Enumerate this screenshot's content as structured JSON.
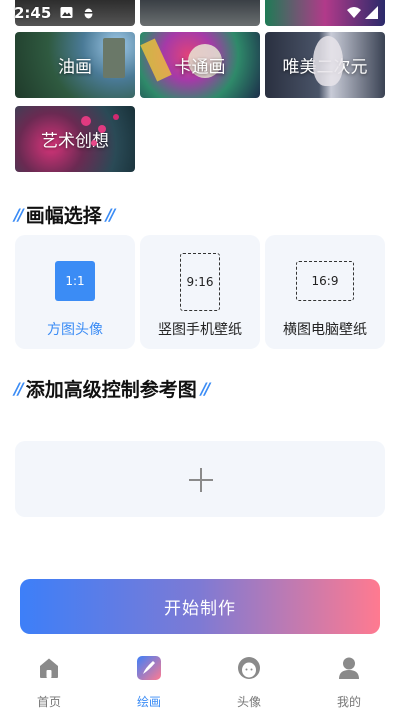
{
  "status_bar": {
    "time": "2:45",
    "icons": [
      "image-icon",
      "bug-icon",
      "wifi-icon",
      "signal-icon"
    ]
  },
  "styles": {
    "items": [
      {
        "label": "油画"
      },
      {
        "label": "卡通画"
      },
      {
        "label": "唯美二次元"
      },
      {
        "label": "艺术创想"
      }
    ]
  },
  "ratio_section": {
    "title": "画幅选择",
    "options": [
      {
        "ratio": "1:1",
        "label": "方图头像",
        "selected": true
      },
      {
        "ratio": "9:16",
        "label": "竖图手机壁纸",
        "selected": false
      },
      {
        "ratio": "16:9",
        "label": "横图电脑壁纸",
        "selected": false
      }
    ]
  },
  "reference_section": {
    "title": "添加高级控制参考图"
  },
  "start_button": {
    "label": "开始制作"
  },
  "tabbar": {
    "items": [
      {
        "label": "首页",
        "icon": "home-icon",
        "active": false
      },
      {
        "label": "绘画",
        "icon": "paint-brush-icon",
        "active": true
      },
      {
        "label": "头像",
        "icon": "avatar-face-icon",
        "active": false
      },
      {
        "label": "我的",
        "icon": "user-icon",
        "active": false
      }
    ]
  },
  "colors": {
    "accent": "#3b8cf5",
    "card_bg": "#f3f6fb",
    "gradient_start": "#3d7ff8",
    "gradient_end": "#ff7a90"
  }
}
